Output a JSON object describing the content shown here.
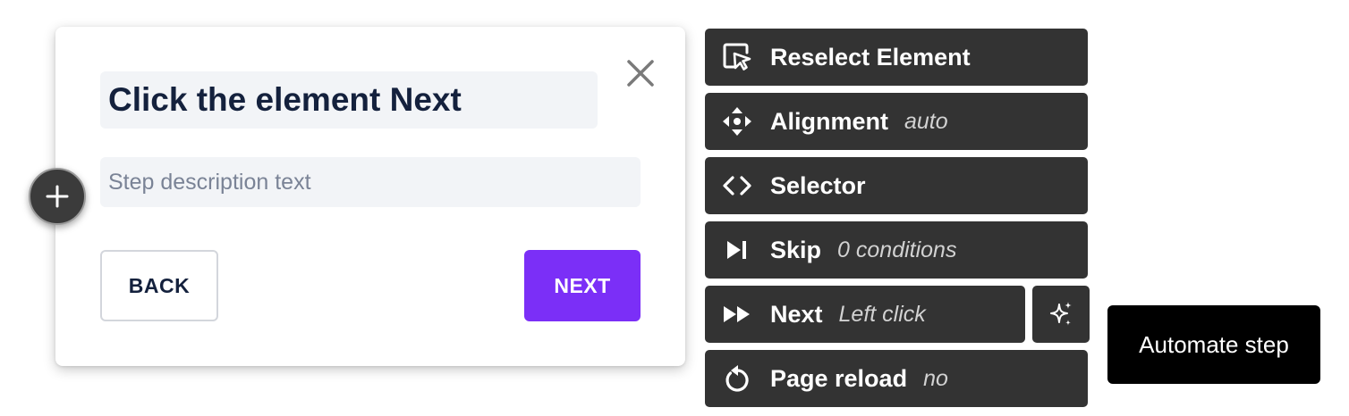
{
  "step_card": {
    "title": "Click the element Next",
    "description_placeholder": "Step description text",
    "back_label": "BACK",
    "next_label": "NEXT",
    "close_icon": "close-icon"
  },
  "add_button": {
    "icon": "plus-icon"
  },
  "options": {
    "reselect": {
      "label": "Reselect Element",
      "icon": "cursor-select-icon"
    },
    "alignment": {
      "label": "Alignment",
      "value": "auto",
      "icon": "move-arrows-icon"
    },
    "selector": {
      "label": "Selector",
      "icon": "code-icon"
    },
    "skip": {
      "label": "Skip",
      "value": "0 conditions",
      "icon": "skip-forward-icon"
    },
    "next": {
      "label": "Next",
      "value": "Left click",
      "icon": "fast-forward-icon"
    },
    "reload": {
      "label": "Page reload",
      "value": "no",
      "icon": "reload-icon"
    }
  },
  "automate": {
    "icon": "sparkles-icon",
    "tooltip": "Automate step"
  },
  "colors": {
    "primary": "#7b2ff7",
    "panel": "#333333",
    "title_text": "#14213d",
    "tooltip_bg": "#000000"
  }
}
